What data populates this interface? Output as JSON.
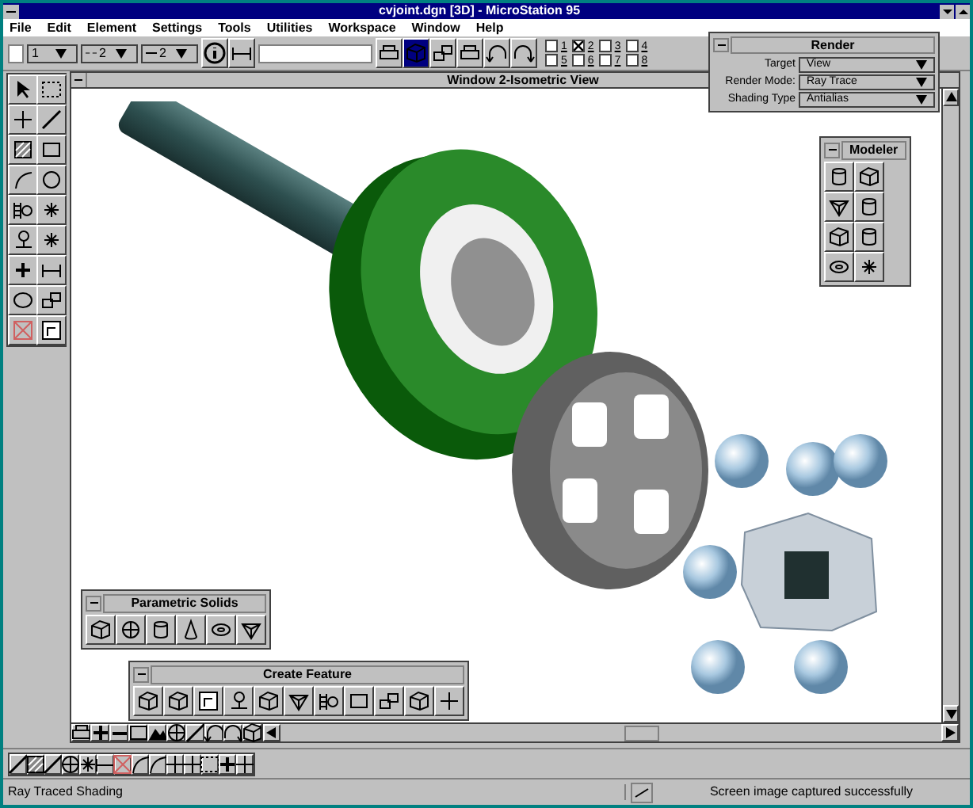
{
  "window": {
    "title": "cvjoint.dgn [3D] - MicroStation 95"
  },
  "menu": [
    "File",
    "Edit",
    "Element",
    "Settings",
    "Tools",
    "Utilities",
    "Workspace",
    "Window",
    "Help"
  ],
  "toolbar": {
    "level": "1",
    "line_style": "2",
    "line_weight": "2",
    "views": [
      {
        "label": "1",
        "checked": false
      },
      {
        "label": "2",
        "checked": true
      },
      {
        "label": "3",
        "checked": false
      },
      {
        "label": "4",
        "checked": false
      },
      {
        "label": "5",
        "checked": false
      },
      {
        "label": "6",
        "checked": false
      },
      {
        "label": "7",
        "checked": false
      },
      {
        "label": "8",
        "checked": false
      }
    ]
  },
  "view_window": {
    "title": "Window 2-Isometric View"
  },
  "render": {
    "title": "Render",
    "fields": [
      {
        "label": "Target",
        "value": "View"
      },
      {
        "label": "Render Mode:",
        "value": "Ray Trace"
      },
      {
        "label": "Shading Type",
        "value": "Antialias"
      }
    ]
  },
  "palettes": [
    {
      "title": "Modeler"
    },
    {
      "title": "Parametric Solids"
    },
    {
      "title": "Create Feature"
    }
  ],
  "status_bar": {
    "message": "Ray Traced Shading",
    "result": "Screen image captured successfully"
  }
}
